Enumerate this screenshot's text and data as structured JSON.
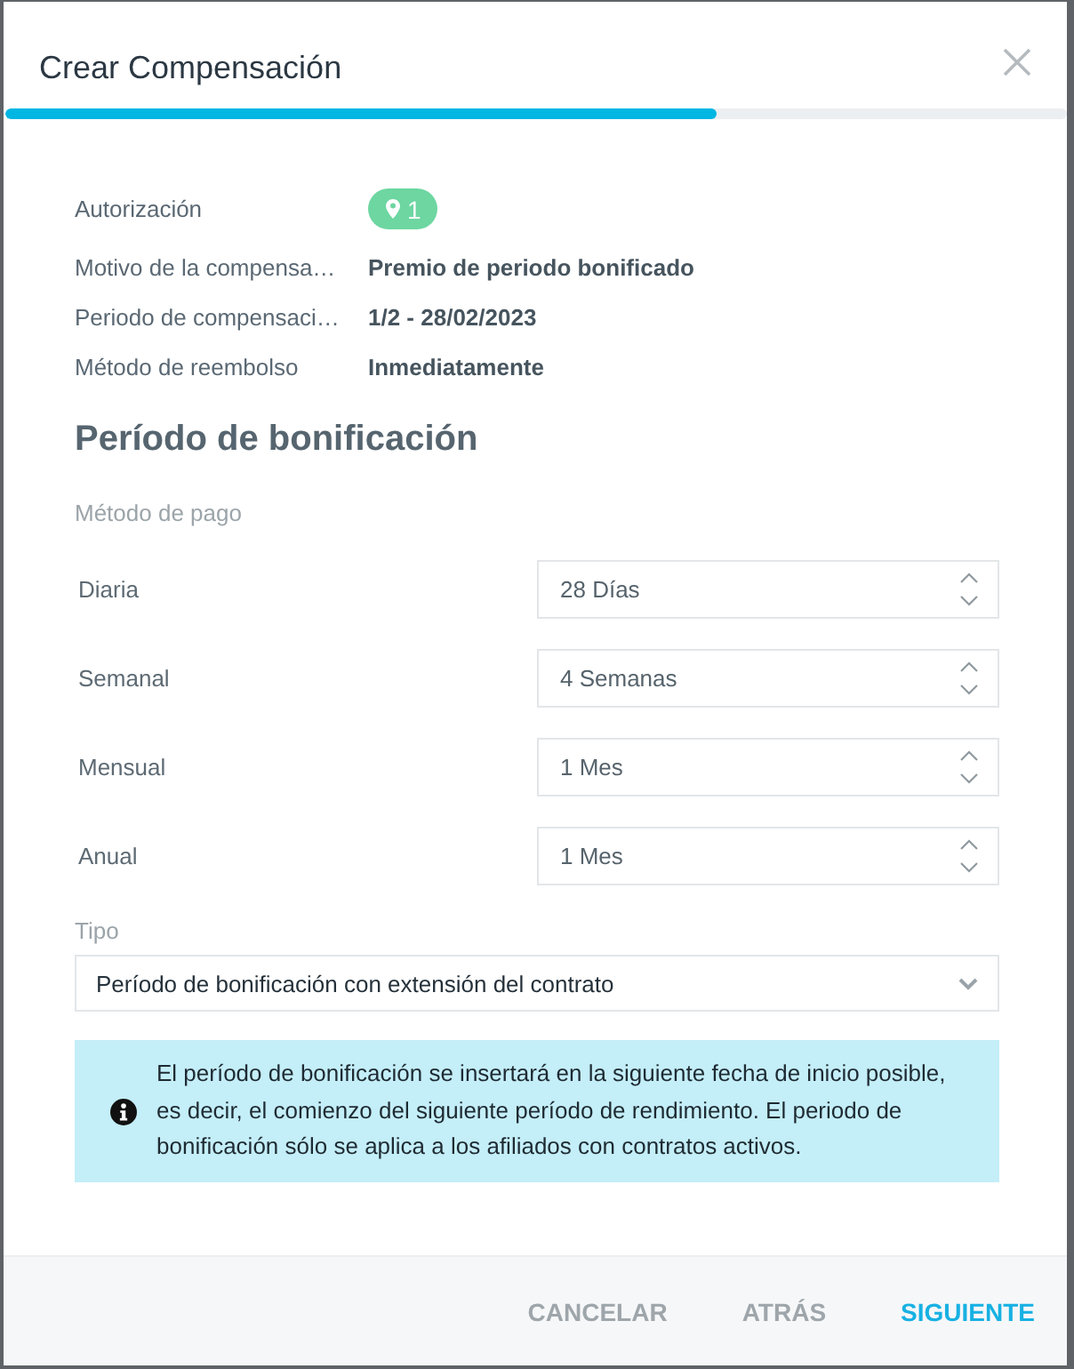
{
  "dialog": {
    "title": "Crear Compensación"
  },
  "progress": {
    "level": 0.67
  },
  "summary": [
    {
      "label": "Autorización",
      "kind": "badge",
      "value": "1"
    },
    {
      "label": "Motivo de la compensa…",
      "kind": "text",
      "value": "Premio de periodo bonificado"
    },
    {
      "label": "Periodo de compensaci…",
      "kind": "text",
      "value": "1/2 - 28/02/2023"
    },
    {
      "label": "Método de reembolso",
      "kind": "text",
      "value": "Inmediatamente"
    }
  ],
  "section": {
    "heading": "Período de bonificación",
    "group_label": "Método de pago"
  },
  "payment_rows": [
    {
      "label": "Diaria",
      "value": "28 Días"
    },
    {
      "label": "Semanal",
      "value": "4 Semanas"
    },
    {
      "label": "Mensual",
      "value": "1 Mes"
    },
    {
      "label": "Anual",
      "value": "1 Mes"
    }
  ],
  "type_field": {
    "label": "Tipo",
    "value": "Período de bonificación con extensión del contrato"
  },
  "info": {
    "text": "El período de bonificación se insertará en la siguiente fecha de inicio posible, es decir, el comienzo del siguiente período de rendimiento. El periodo de bonificación sólo se aplica a los afiliados con contratos activos."
  },
  "footer": {
    "buttons": [
      {
        "label": "CANCELAR",
        "kind": "secondary"
      },
      {
        "label": "ATRÁS",
        "kind": "secondary"
      },
      {
        "label": "SIGUIENTE",
        "kind": "primary"
      }
    ]
  }
}
